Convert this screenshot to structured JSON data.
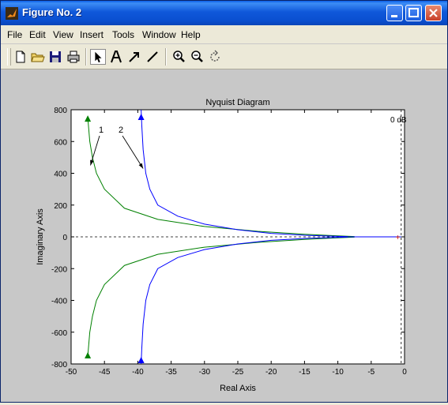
{
  "window": {
    "title": "Figure No. 2"
  },
  "menu": [
    "File",
    "Edit",
    "View",
    "Insert",
    "Tools",
    "Window",
    "Help"
  ],
  "toolbar_icons": [
    "new-file-icon",
    "open-folder-icon",
    "save-icon",
    "print-icon",
    "select-arrow-icon",
    "insert-text-icon",
    "insert-arrow-icon",
    "insert-line-icon",
    "zoom-in-icon",
    "zoom-out-icon",
    "rotate-icon"
  ],
  "colors": {
    "series1": "#008000",
    "series2": "#0000ff",
    "titlebar": "#0a5fe8"
  },
  "chart_data": {
    "type": "line",
    "title": "Nyquist Diagram",
    "xlabel": "Real Axis",
    "ylabel": "Imaginary Axis",
    "xlim": [
      -50,
      0
    ],
    "ylim": [
      -800,
      800
    ],
    "xticks": [
      "-50",
      "-45",
      "-40",
      "-35",
      "-30",
      "-25",
      "-20",
      "-15",
      "-10",
      "-5",
      "0"
    ],
    "yticks": [
      "800",
      "600",
      "400",
      "200",
      "0",
      "-200",
      "-400",
      "-600",
      "-800"
    ],
    "annotations": [
      "1",
      "2",
      "0 dB"
    ],
    "grid": false,
    "series": [
      {
        "name": "1",
        "color": "#008000",
        "x": [
          -47.5,
          -47.4,
          -47.2,
          -46.8,
          -46.2,
          -45,
          -42,
          -37,
          -30,
          -22,
          -15,
          -10,
          -7.5
        ],
        "y": [
          750,
          700,
          600,
          500,
          400,
          300,
          180,
          110,
          65,
          35,
          16,
          6,
          2
        ]
      },
      {
        "name": "2",
        "color": "#0000ff",
        "x": [
          -39.5,
          -39.4,
          -39.2,
          -38.8,
          -38.2,
          -37,
          -34,
          -30,
          -25,
          -20,
          -15,
          -10,
          -8.5
        ],
        "y": [
          800,
          700,
          550,
          400,
          300,
          200,
          130,
          80,
          45,
          22,
          10,
          3,
          1
        ]
      }
    ]
  }
}
